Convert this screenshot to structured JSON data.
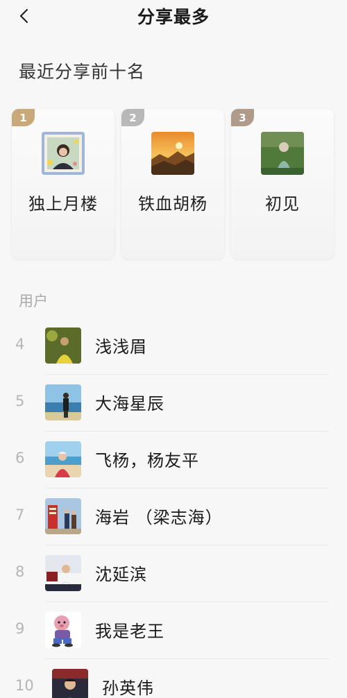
{
  "header": {
    "back_icon": "chevron-left-icon",
    "title": "分享最多"
  },
  "top_section": {
    "heading": "最近分享前十名",
    "cards": [
      {
        "rank": "1",
        "name": "独上月楼",
        "badge_color": "#c9a97a"
      },
      {
        "rank": "2",
        "name": "铁血胡杨",
        "badge_color": "#b8b8b8"
      },
      {
        "rank": "3",
        "name": "初见",
        "badge_color": "#b09a8a"
      }
    ]
  },
  "users_section": {
    "heading": "用户",
    "rows": [
      {
        "rank": "4",
        "name": "浅浅眉"
      },
      {
        "rank": "5",
        "name": "大海星辰"
      },
      {
        "rank": "6",
        "name": "飞杨，杨友平"
      },
      {
        "rank": "7",
        "name": "海岩 （梁志海）"
      },
      {
        "rank": "8",
        "name": "沈延滨"
      },
      {
        "rank": "9",
        "name": "我是老王"
      },
      {
        "rank": "10",
        "name": "孙英伟"
      }
    ]
  }
}
